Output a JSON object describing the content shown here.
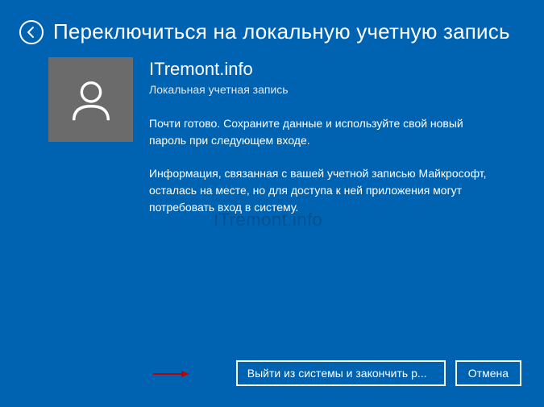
{
  "header": {
    "title": "Переключиться на локальную учетную запись"
  },
  "account": {
    "name": "ITremont.info",
    "type": "Локальная учетная запись"
  },
  "body": {
    "paragraph1": "Почти готово. Сохраните данные и используйте свой новый пароль при следующем входе.",
    "paragraph2": "Информация, связанная с вашей учетной записью Майкрософт, осталась на месте, но для доступа к ней приложения могут потребовать вход в систему."
  },
  "buttons": {
    "primary": "Выйти из системы и закончить р...",
    "cancel": "Отмена"
  },
  "watermark": "ITremont.info",
  "colors": {
    "background": "#0063b1",
    "avatar": "#6b6b6b"
  }
}
